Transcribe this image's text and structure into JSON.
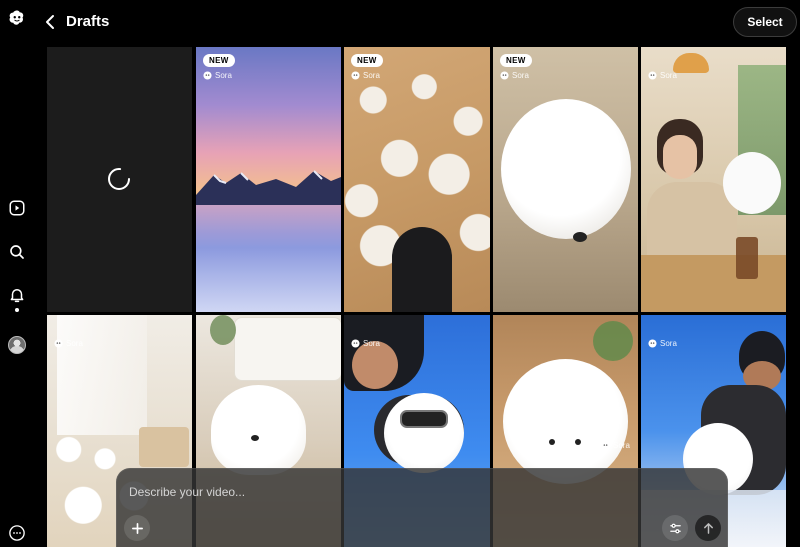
{
  "header": {
    "title": "Drafts",
    "select_label": "Select"
  },
  "sidebar": {
    "icons": [
      "openai-logo-icon",
      "play-icon",
      "search-icon",
      "bell-icon",
      "avatar",
      "more-icon"
    ]
  },
  "grid": {
    "tiles": [
      {
        "name": "generating-tile",
        "badge": "",
        "source": ""
      },
      {
        "name": "mountain-lake-tile",
        "badge": "NEW",
        "source": "Sora"
      },
      {
        "name": "dog-crowd-tile",
        "badge": "NEW",
        "source": "Sora"
      },
      {
        "name": "fluffy-dog-tile",
        "badge": "NEW",
        "source": "Sora"
      },
      {
        "name": "cafe-woman-tile",
        "badge": "",
        "source": "Sora"
      },
      {
        "name": "living-room-dogs-tile",
        "badge": "",
        "source": "Sora"
      },
      {
        "name": "dog-on-floor-tile",
        "badge": "",
        "source": ""
      },
      {
        "name": "skydiving-man-tile",
        "badge": "",
        "source": "Sora"
      },
      {
        "name": "fluffy-dog-closeup-tile",
        "badge": "",
        "source": "Sora"
      },
      {
        "name": "skydiving-dog-tile",
        "badge": "",
        "source": "Sora"
      }
    ]
  },
  "prompt": {
    "placeholder": "Describe your video..."
  },
  "colors": {
    "background": "#000000",
    "badge": "#ffffff",
    "prompt_bg": "#343434"
  }
}
